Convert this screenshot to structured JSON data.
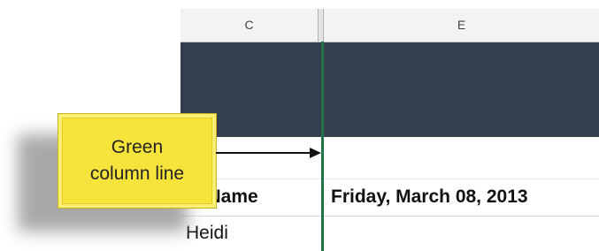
{
  "columns": {
    "c_label": "C",
    "e_label": "E"
  },
  "header_row": {
    "first_name": "st Name",
    "date": "Friday, March 08, 2013"
  },
  "data_row": {
    "first_name": "Heidi",
    "date": ""
  },
  "callout": {
    "line1": "Green",
    "line2": "column line"
  },
  "colors": {
    "title_band": "#333f4f",
    "green_line": "#217346",
    "callout_fill": "#f6e43d"
  },
  "icons": {
    "arrow": "arrow-right-icon"
  }
}
